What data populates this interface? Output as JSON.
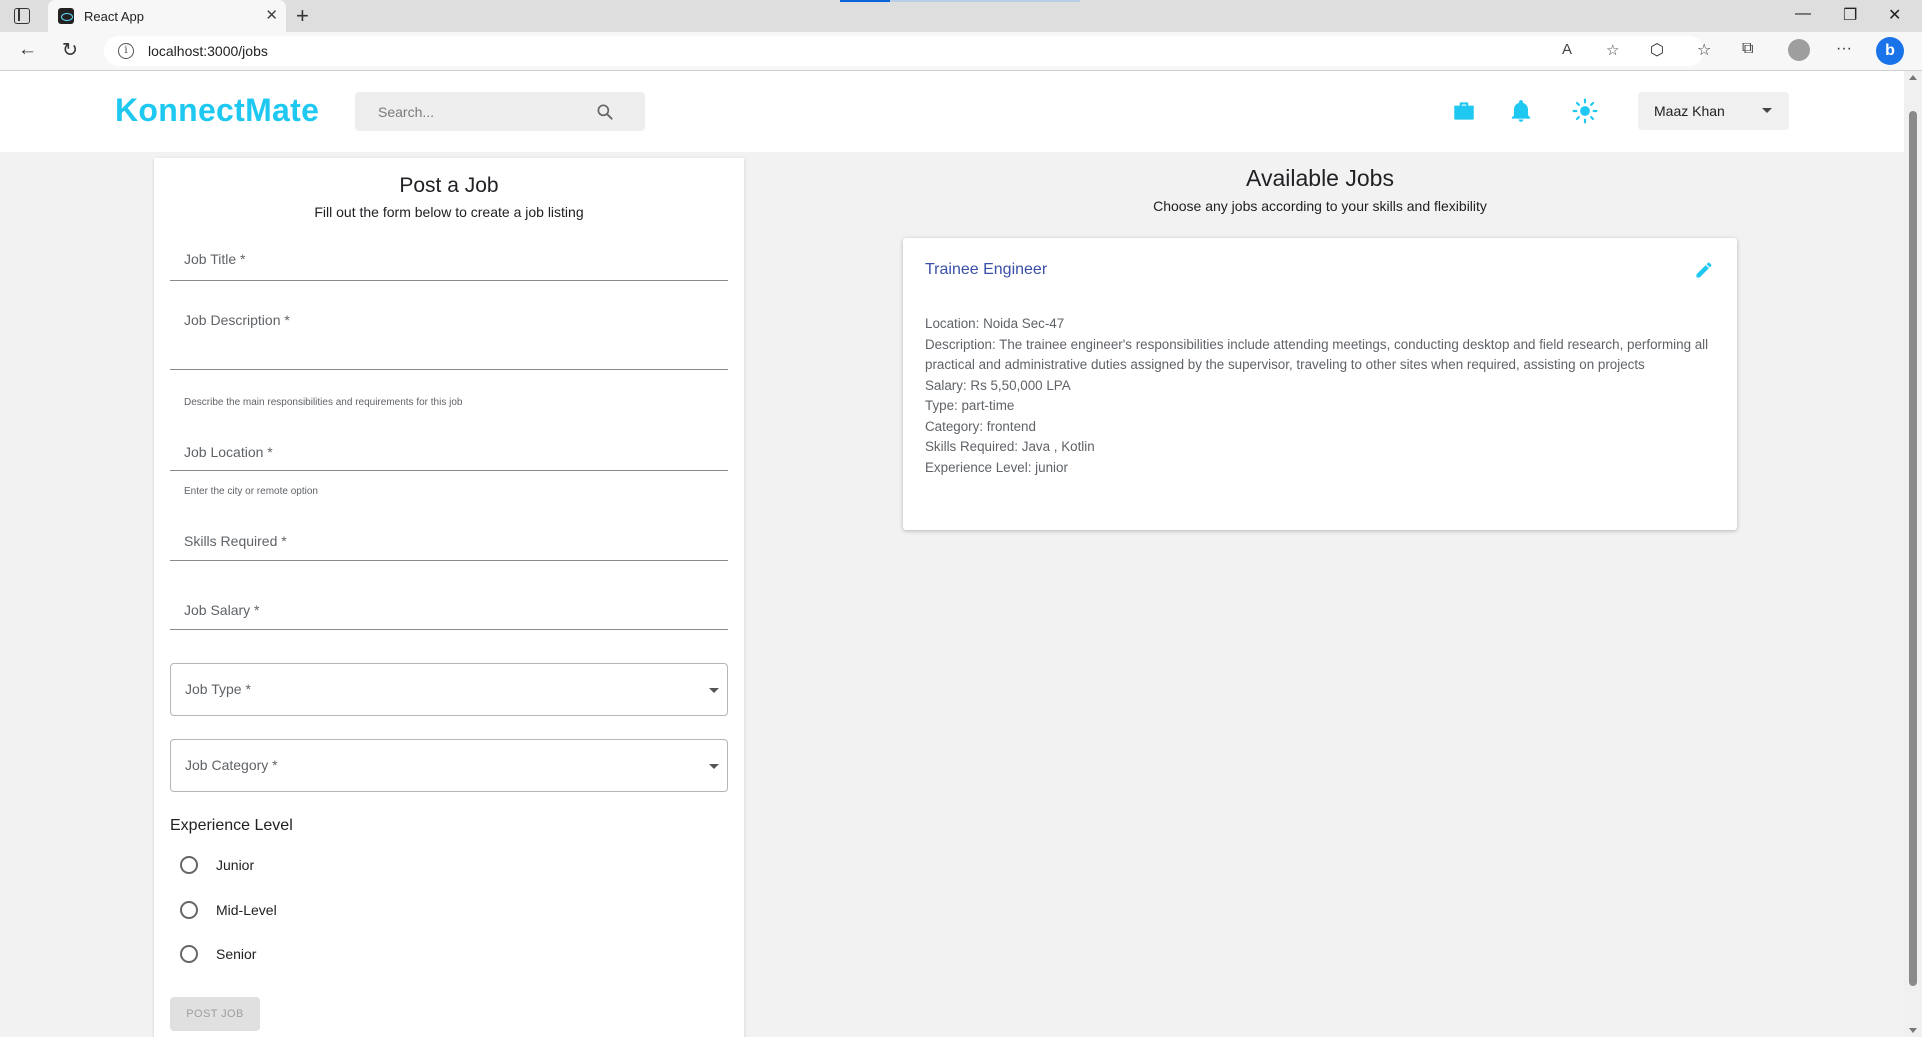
{
  "browser": {
    "tab_title": "React App",
    "url": "localhost:3000/jobs"
  },
  "header": {
    "brand": "KonnectMate",
    "search_placeholder": "Search...",
    "user_name": "Maaz Khan",
    "accent_color": "#1ec8f0"
  },
  "form": {
    "title": "Post a Job",
    "subtitle": "Fill out the form below to create a job listing",
    "fields": {
      "job_title": "Job Title *",
      "job_description": "Job Description *",
      "job_description_helper": "Describe the main responsibilities and requirements for this job",
      "job_location": "Job Location *",
      "job_location_helper": "Enter the city or remote option",
      "skills_required": "Skills Required *",
      "job_salary": "Job Salary *",
      "job_type": "Job Type *",
      "job_category": "Job Category *"
    },
    "experience": {
      "title": "Experience Level",
      "options": [
        "Junior",
        "Mid-Level",
        "Senior"
      ]
    },
    "submit_label": "POST JOB"
  },
  "jobs": {
    "title": "Available Jobs",
    "subtitle": "Choose any jobs according to your skills and flexibility",
    "items": [
      {
        "title": "Trainee Engineer",
        "location": "Location: Noida Sec-47",
        "description": "Description: The trainee engineer's responsibilities include attending meetings, conducting desktop and field research, performing all practical and administrative duties assigned by the supervisor, traveling to other sites when required, assisting on projects",
        "salary": "Salary: Rs 5,50,000 LPA",
        "type": "Type: part-time",
        "category": "Category: frontend",
        "skills": "Skills Required: Java , Kotlin",
        "experience": "Experience Level: junior"
      }
    ]
  }
}
